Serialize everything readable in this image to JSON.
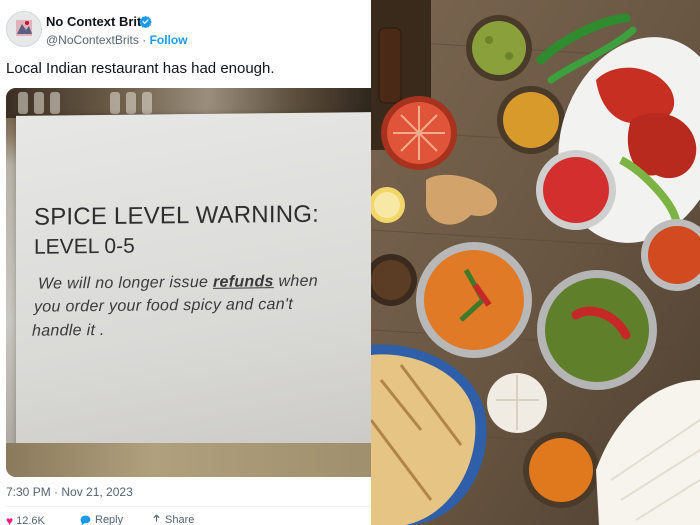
{
  "tweet": {
    "author_name": "No Context Brits",
    "author_handle": "@NoContextBrits",
    "separator": "·",
    "follow_label": "Follow",
    "text": "Local Indian restaurant has had enough.",
    "timestamp": "7:30 PM · Nov 21, 2023",
    "actions": {
      "like_count": "12.6K",
      "reply_label": "Reply",
      "share_label": "Share"
    }
  },
  "sign": {
    "title": "SPICE LEVEL WARNING:",
    "level": "LEVEL 0-5",
    "line1_pre": "We will no longer issue ",
    "line1_bold": "refunds",
    "line1_post": " when",
    "line2": "you order your food spicy and can't",
    "line3": "handle it ."
  },
  "colors": {
    "accent": "#1d9bf0",
    "text": "#0f1419",
    "secondary": "#536471",
    "like": "#f91880"
  }
}
